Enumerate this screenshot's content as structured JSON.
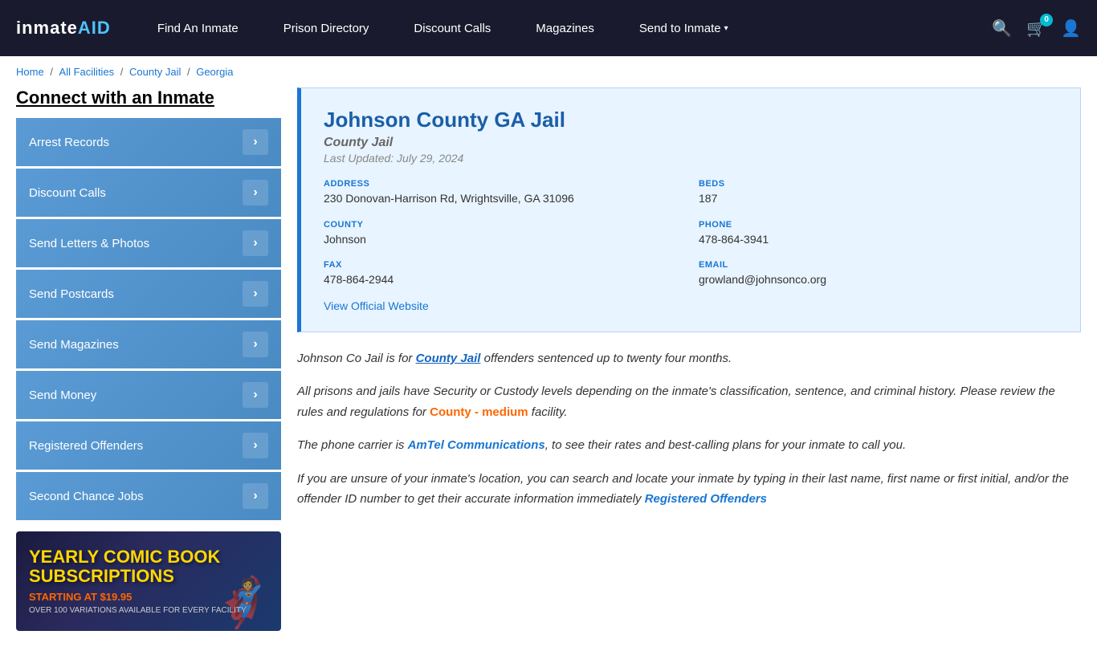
{
  "header": {
    "logo": "inmateAID",
    "nav": [
      {
        "label": "Find An Inmate",
        "has_arrow": false
      },
      {
        "label": "Prison Directory",
        "has_arrow": false
      },
      {
        "label": "Discount Calls",
        "has_arrow": false
      },
      {
        "label": "Magazines",
        "has_arrow": false
      },
      {
        "label": "Send to Inmate",
        "has_arrow": true
      }
    ],
    "cart_count": "0",
    "icons": [
      "search",
      "cart",
      "user"
    ]
  },
  "breadcrumb": {
    "items": [
      "Home",
      "All Facilities",
      "County Jail",
      "Georgia"
    ],
    "separators": [
      "/",
      "/",
      "/"
    ]
  },
  "sidebar": {
    "title": "Connect with an Inmate",
    "menu_items": [
      "Arrest Records",
      "Discount Calls",
      "Send Letters & Photos",
      "Send Postcards",
      "Send Magazines",
      "Send Money",
      "Registered Offenders",
      "Second Chance Jobs"
    ]
  },
  "ad": {
    "line1": "YEARLY COMIC BOOK",
    "line2": "SUBSCRIPTIONS",
    "line3": "STARTING AT $19.95",
    "line4": "OVER 100 VARIATIONS AVAILABLE FOR EVERY FACILITY",
    "hero": "🦸"
  },
  "facility": {
    "name": "Johnson County GA Jail",
    "type": "County Jail",
    "last_updated": "Last Updated: July 29, 2024",
    "address_label": "ADDRESS",
    "address_value": "230 Donovan-Harrison Rd, Wrightsville, GA 31096",
    "beds_label": "BEDS",
    "beds_value": "187",
    "county_label": "COUNTY",
    "county_value": "Johnson",
    "phone_label": "PHONE",
    "phone_value": "478-864-3941",
    "fax_label": "FAX",
    "fax_value": "478-864-2944",
    "email_label": "EMAIL",
    "email_value": "growland@johnsonco.org",
    "website_label": "View Official Website"
  },
  "description": {
    "para1_before": "Johnson Co Jail is for ",
    "para1_highlight": "County Jail",
    "para1_after": " offenders sentenced up to twenty four months.",
    "para2_before": "All prisons and jails have Security or Custody levels depending on the inmate's classification, sentence, and criminal history. Please review the rules and regulations for ",
    "para2_highlight": "County - medium",
    "para2_after": " facility.",
    "para3_before": "The phone carrier is ",
    "para3_highlight": "AmTel Communications",
    "para3_after": ", to see their rates and best-calling plans for your inmate to call you.",
    "para4": "If you are unsure of your inmate's location, you can search and locate your inmate by typing in their last name, first name or first initial, and/or the offender ID number to get their accurate information immediately",
    "para4_link": "Registered Offenders"
  }
}
